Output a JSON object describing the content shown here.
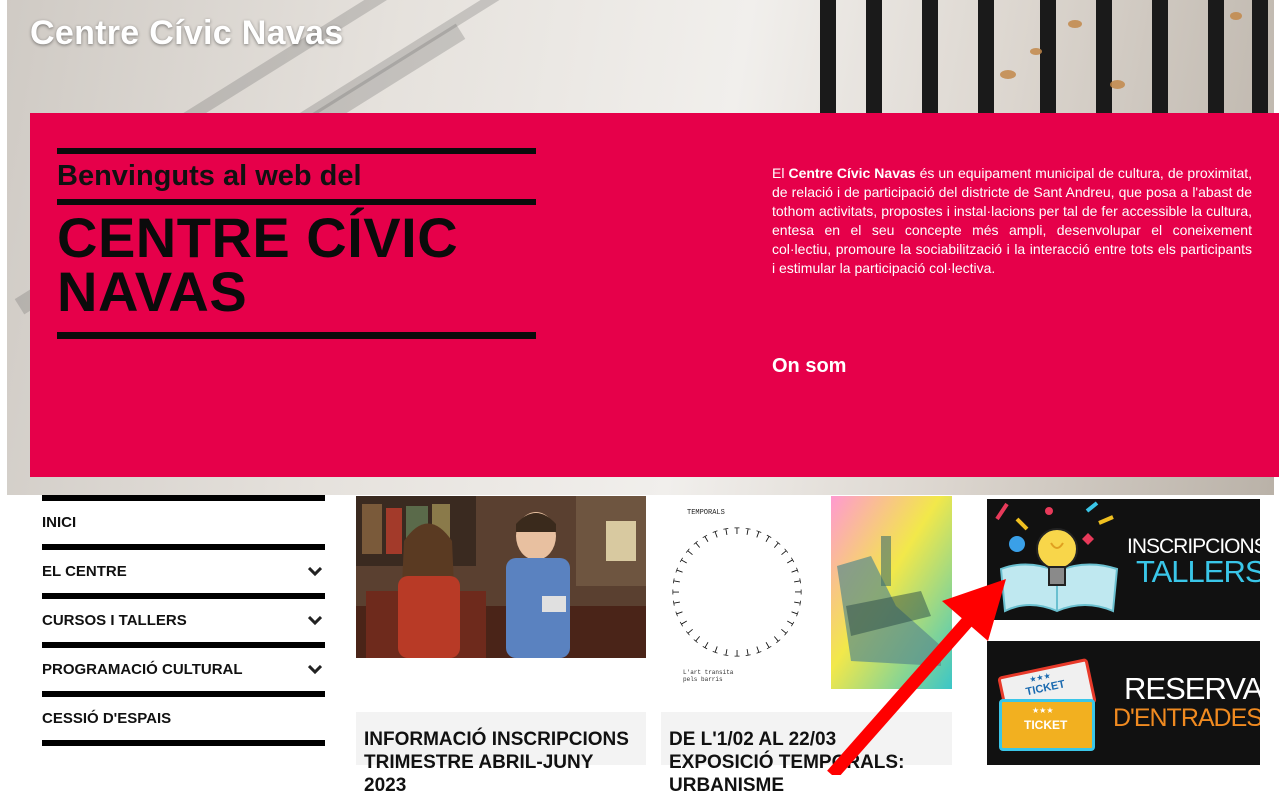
{
  "site": {
    "title": "Centre Cívic Navas"
  },
  "hero": {
    "welcome": "Benvinguts al web del",
    "name_line1": "CENTRE CÍVIC",
    "name_line2": "NAVAS",
    "desc_prefix": "El ",
    "desc_bold": "Centre Cívic Navas",
    "desc_rest": " és un equipament municipal de cultura, de proximitat, de relació i de participació del districte de Sant Andreu, que posa a l'abast de tothom activitats, propostes i instal·lacions per tal de fer accessible la cultura, entesa en el seu concepte més ampli, desenvolupar el coneixement col·lectiu, promoure la sociabilització i la interacció entre tots els participants i estimular la participació col·lectiva.",
    "location_link": "On som",
    "color": "#e6004a"
  },
  "menu": {
    "items": [
      {
        "label": "INICI",
        "has_submenu": false
      },
      {
        "label": "EL CENTRE",
        "has_submenu": true
      },
      {
        "label": "CURSOS I TALLERS",
        "has_submenu": true
      },
      {
        "label": "PROGRAMACIÓ CULTURAL",
        "has_submenu": true
      },
      {
        "label": "CESSIÓ D'ESPAIS",
        "has_submenu": false
      }
    ]
  },
  "news": [
    {
      "title": "INFORMACIÓ INSCRIPCIONS TRIMESTRE ABRIL-JUNY 2023"
    },
    {
      "title": "DE L'1/02 AL 22/03 EXPOSICIÓ TEMPORALS: URBANISME",
      "poster_title": "TEMPORALS",
      "poster_caption_line1": "L'art transita",
      "poster_caption_line2": "pels barris"
    }
  ],
  "banners": {
    "workshops": {
      "line1": "INSCRIPCIONS",
      "line2": "TALLERS"
    },
    "tickets": {
      "line1": "RESERVA",
      "line2": "D'ENTRADES",
      "ticket_text": "TICKET",
      "stars": "★★★"
    }
  }
}
